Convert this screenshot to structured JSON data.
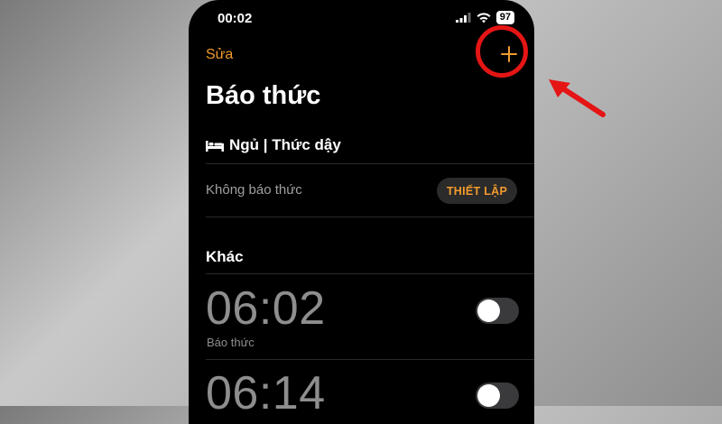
{
  "status_bar": {
    "time": "00:02",
    "battery": "97",
    "icons": [
      "signal-icon",
      "wifi-icon",
      "battery-icon"
    ]
  },
  "nav": {
    "edit_label": "Sửa",
    "add_icon": "plus-icon"
  },
  "title": "Báo thức",
  "sleep_section": {
    "icon": "bed-icon",
    "label": "Ngủ | Thức dậy",
    "status": "Không báo thức",
    "setup_label": "THIẾT LẬP"
  },
  "other_section": {
    "header": "Khác"
  },
  "alarms": [
    {
      "time": "06:02",
      "label": "Báo thức",
      "enabled": false
    },
    {
      "time": "06:14",
      "label": "",
      "enabled": false
    }
  ],
  "colors": {
    "accent": "#f29a2e",
    "annotation": "#e51515",
    "background": "#000000"
  }
}
